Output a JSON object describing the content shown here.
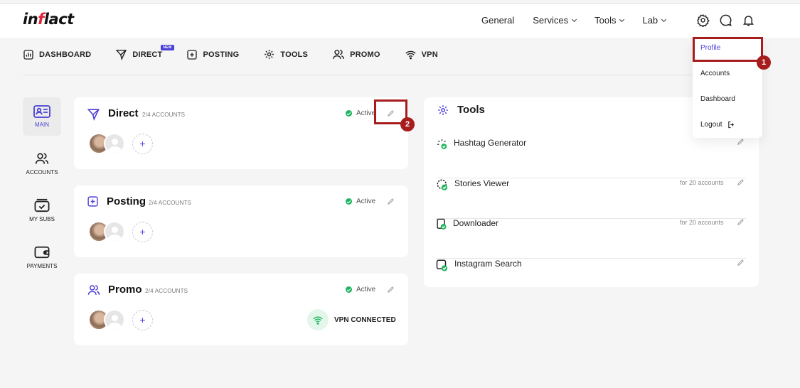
{
  "header": {
    "logo_main": "in",
    "logo_mid": "f",
    "logo_end": "lact",
    "nav": [
      {
        "label": "General",
        "has_dropdown": false
      },
      {
        "label": "Services",
        "has_dropdown": true
      },
      {
        "label": "Tools",
        "has_dropdown": true
      },
      {
        "label": "Lab",
        "has_dropdown": true
      }
    ],
    "icons": [
      "gear-icon",
      "chat-icon",
      "bell-icon"
    ]
  },
  "subnav": {
    "items": [
      {
        "label": "DASHBOARD",
        "icon": "dashboard-icon"
      },
      {
        "label": "DIRECT",
        "icon": "send-icon",
        "badge": "NEW"
      },
      {
        "label": "POSTING",
        "icon": "plus-square-icon"
      },
      {
        "label": "TOOLS",
        "icon": "tools-icon"
      },
      {
        "label": "PROMO",
        "icon": "users-icon"
      },
      {
        "label": "VPN",
        "icon": "wifi-icon"
      }
    ]
  },
  "sidebar": {
    "items": [
      {
        "label": "MAIN",
        "icon": "id-card-icon",
        "active": true
      },
      {
        "label": "ACCOUNTS",
        "icon": "users-icon"
      },
      {
        "label": "MY SUBS",
        "icon": "subscription-icon"
      },
      {
        "label": "PAYMENTS",
        "icon": "wallet-icon"
      }
    ]
  },
  "cards": [
    {
      "title": "Direct",
      "accounts": "2/4 ACCOUNTS",
      "status": "Active"
    },
    {
      "title": "Posting",
      "accounts": "2/4 ACCOUNTS",
      "status": "Active"
    },
    {
      "title": "Promo",
      "accounts": "2/4 ACCOUNTS",
      "status": "Active",
      "vpn": "VPN CONNECTED"
    }
  ],
  "add_label": "+",
  "tools": {
    "title": "Tools",
    "items": [
      {
        "label": "Hashtag Generator",
        "note": ""
      },
      {
        "label": "Stories Viewer",
        "note": "for 20 accounts"
      },
      {
        "label": "Downloader",
        "note": "for 20 accounts"
      },
      {
        "label": "Instagram Search",
        "note": ""
      }
    ]
  },
  "dropdown": {
    "items": [
      {
        "label": "Profile",
        "active": true
      },
      {
        "label": "Accounts"
      },
      {
        "label": "Dashboard"
      },
      {
        "label": "Logout"
      }
    ]
  },
  "annotations": {
    "marker_1": "1",
    "marker_2": "2",
    "color": "#a71c1c"
  },
  "colors": {
    "accent": "#4b3fd6",
    "active_green": "#1fb45e"
  }
}
